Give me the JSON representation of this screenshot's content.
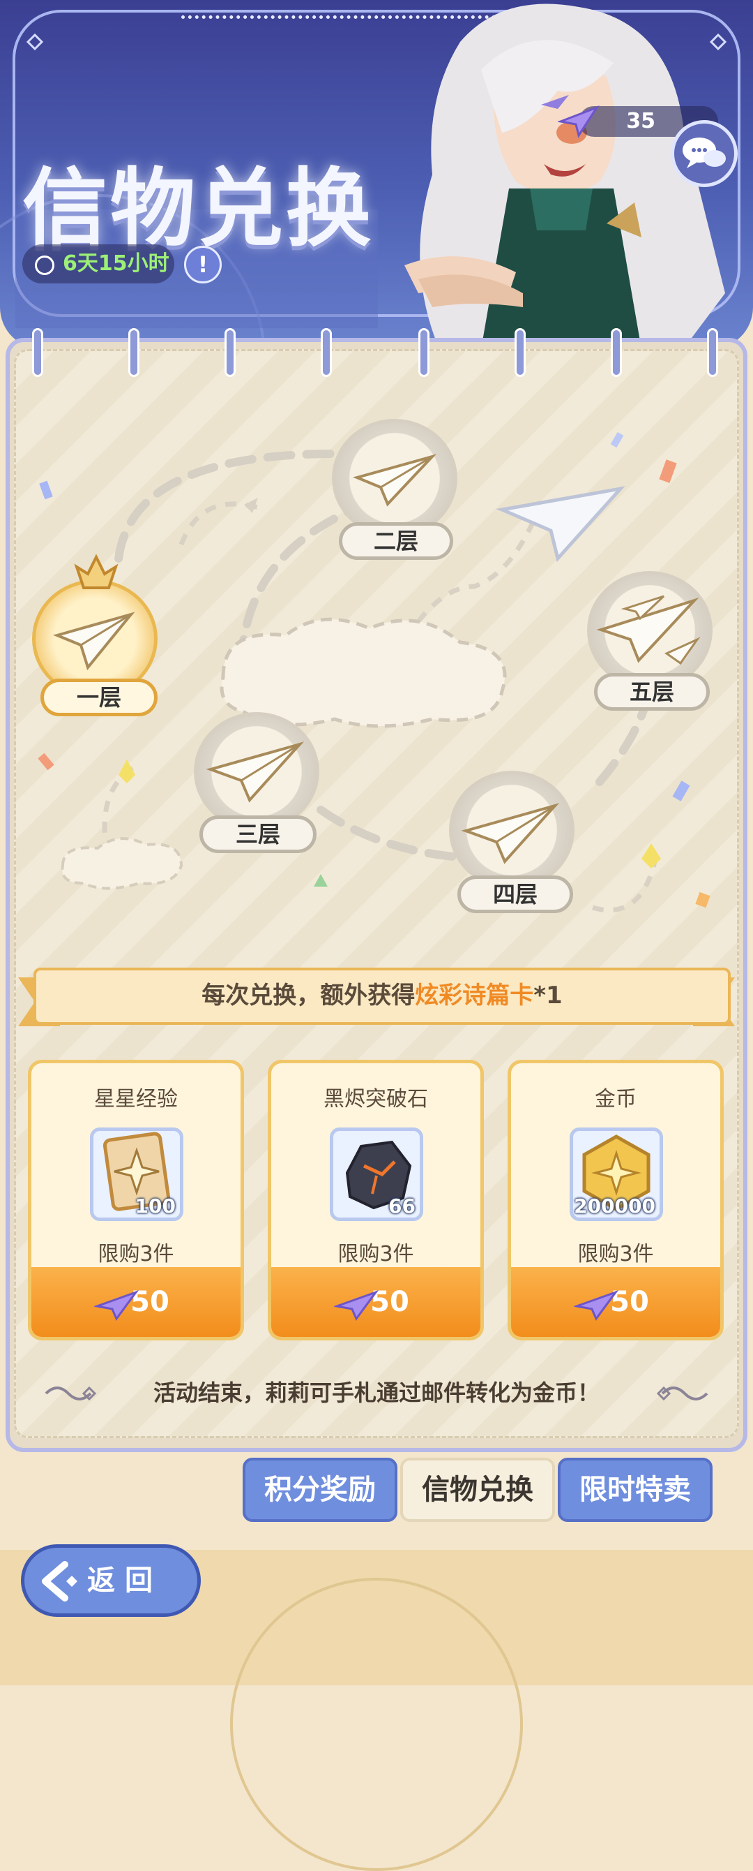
{
  "header": {
    "title": "信物兑换",
    "timer": "6天15小时",
    "currency_count": "35"
  },
  "map": {
    "floors": [
      {
        "label": "一层",
        "active": true
      },
      {
        "label": "二层",
        "active": false
      },
      {
        "label": "三层",
        "active": false
      },
      {
        "label": "四层",
        "active": false
      },
      {
        "label": "五层",
        "active": false
      }
    ]
  },
  "ribbon": {
    "prefix": "每次兑换，额外获得",
    "highlight": "炫彩诗篇卡",
    "suffix": "*1"
  },
  "shop": {
    "items": [
      {
        "name": "星星经验",
        "count": "100",
        "limit": "限购3件",
        "price": "50",
        "icon": "star-card-icon"
      },
      {
        "name": "黑烬突破石",
        "count": "66",
        "limit": "限购3件",
        "price": "50",
        "icon": "black-stone-icon"
      },
      {
        "name": "金币",
        "count": "200000",
        "limit": "限购3件",
        "price": "50",
        "icon": "gold-coin-icon"
      }
    ]
  },
  "notice": "活动结束，莉莉可手札通过邮件转化为金币！",
  "tabs": [
    {
      "label": "积分奖励",
      "active": false
    },
    {
      "label": "信物兑换",
      "active": true
    },
    {
      "label": "限时特卖",
      "active": false
    }
  ],
  "back_button": {
    "label": "返回"
  },
  "colors": {
    "accent_orange": "#f28d1c",
    "accent_blue": "#6f8ede",
    "timer_green": "#9df077",
    "highlight_text": "#f08a24"
  }
}
